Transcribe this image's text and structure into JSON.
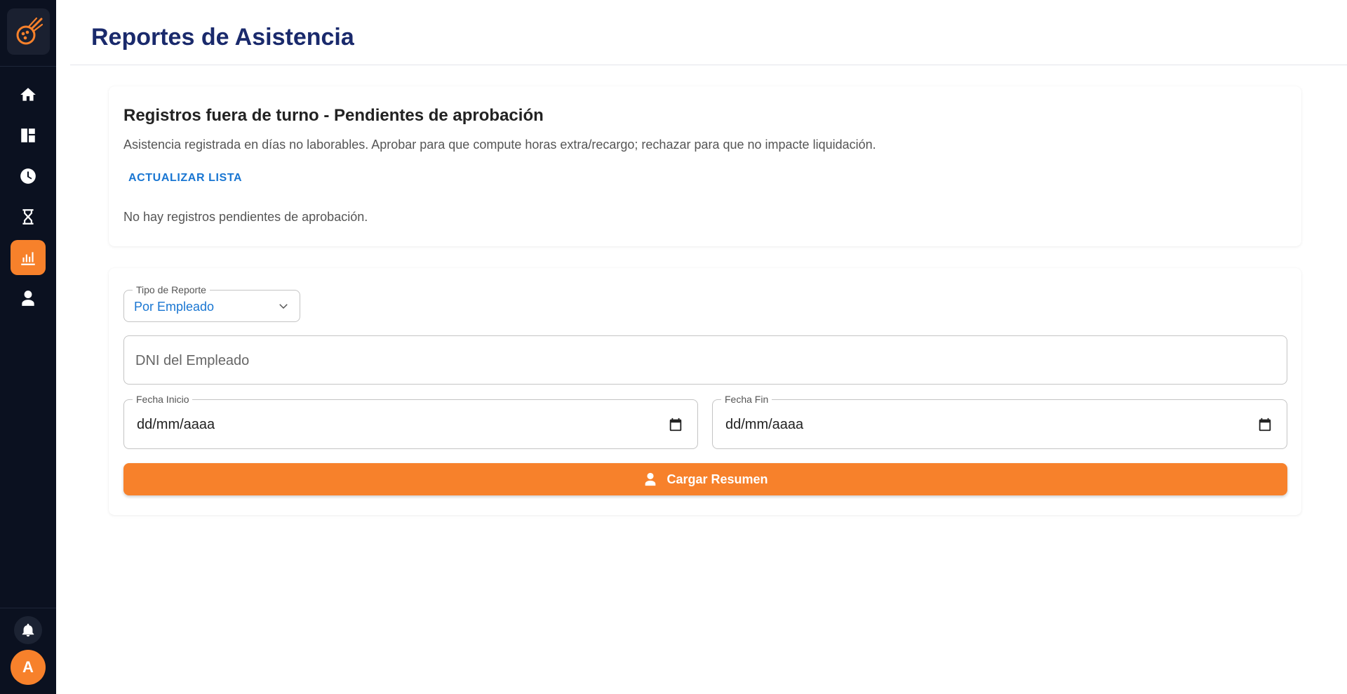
{
  "colors": {
    "sidebar_bg": "#0b1120",
    "accent": "#f7812b",
    "title": "#1a2a6c",
    "link": "#1976d2"
  },
  "sidebar": {
    "logo_icon": "comet-logo-icon",
    "items": [
      {
        "icon": "home-icon",
        "active": false
      },
      {
        "icon": "dashboard-icon",
        "active": false
      },
      {
        "icon": "clock-icon",
        "active": false
      },
      {
        "icon": "hourglass-icon",
        "active": false
      },
      {
        "icon": "bar-chart-icon",
        "active": true
      },
      {
        "icon": "person-icon",
        "active": false
      }
    ],
    "bell_icon": "bell-icon",
    "avatar_initial": "A"
  },
  "header": {
    "title": "Reportes de Asistencia"
  },
  "pending": {
    "title": "Registros fuera de turno - Pendientes de aprobación",
    "description": "Asistencia registrada en días no laborables. Aprobar para que compute horas extra/recargo; rechazar para que no impacte liquidación.",
    "refresh_label": "ACTUALIZAR LISTA",
    "empty_message": "No hay registros pendientes de aprobación."
  },
  "report_form": {
    "type_label": "Tipo de Reporte",
    "type_value": "Por Empleado",
    "dni_placeholder": "DNI del Empleado",
    "start_label": "Fecha Inicio",
    "start_value": "dd/mm/aaaa",
    "end_label": "Fecha Fin",
    "end_value": "dd/mm/aaaa",
    "submit_label": "Cargar Resumen"
  }
}
